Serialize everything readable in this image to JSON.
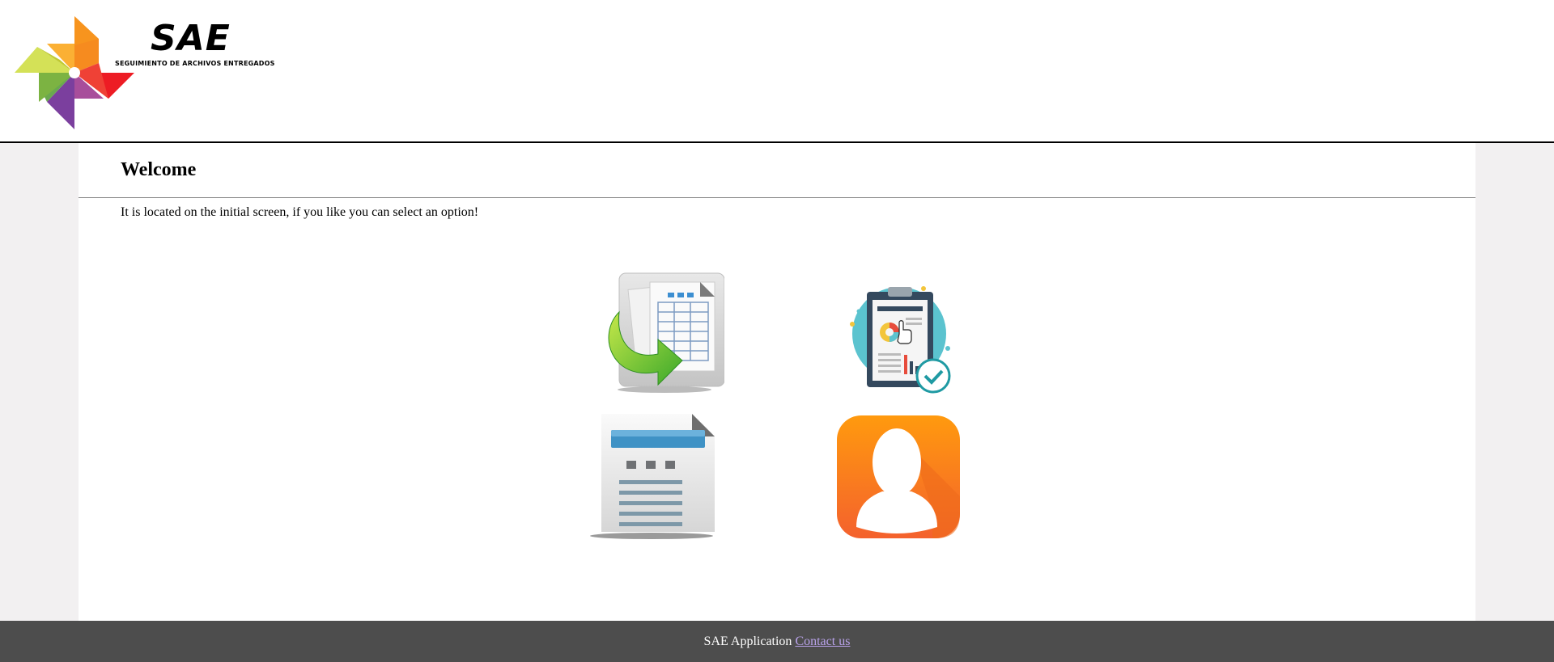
{
  "header": {
    "logo_title": "SAE",
    "logo_subtitle": "SEGUIMIENTO DE ARCHIVOS ENTREGADOS"
  },
  "main": {
    "title": "Welcome",
    "text": "It is located on the initial screen, if you like you can select an option!",
    "options": [
      {
        "icon": "spreadsheet-import-icon"
      },
      {
        "icon": "clipboard-report-icon"
      },
      {
        "icon": "document-icon"
      },
      {
        "icon": "user-profile-icon"
      }
    ]
  },
  "footer": {
    "app_name": "SAE Application",
    "contact_link": "Contact us"
  },
  "colors": {
    "header_bg": "#ffffff",
    "page_bg": "#f2f0f1",
    "footer_bg": "#4d4d4d",
    "link": "#b9a2ea",
    "profile_orange": "#fb7d1a"
  }
}
